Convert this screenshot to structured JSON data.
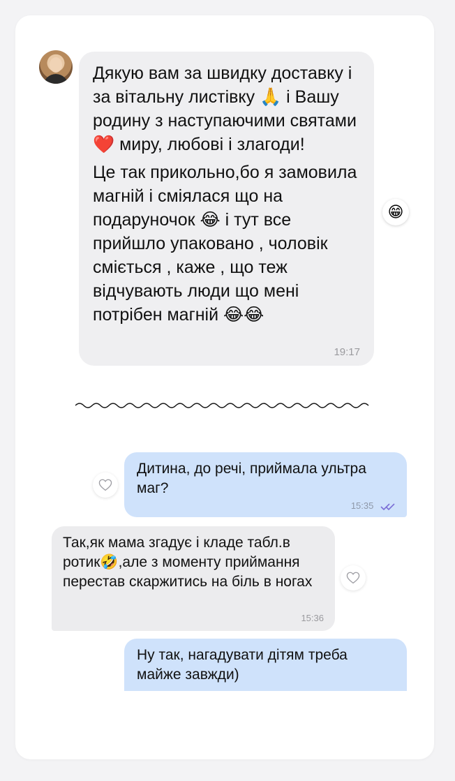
{
  "review": {
    "message_paragraphs": [
      "Дякую вам за швидку доставку і за вітальну листівку 🙏 і Вашу родину з наступаючими святами ❤️ миру, любові і злагоди!",
      "Це так прикольно,бо я замовила магній і сміялася що на подаруночок 😂 і тут все прийшло упаковано , чоловік сміється , каже , що теж відчувають люди що мені потрібен магній 😂😂"
    ],
    "message_time": "19:17",
    "reaction_emoji": "😁"
  },
  "chat": {
    "messages": [
      {
        "direction": "out",
        "text": "Дитина, до речі, приймала ультра маг?",
        "time": "15:35",
        "read": true
      },
      {
        "direction": "in",
        "text": "Так,як мама згадує і кладе табл.в ротик🤣,але з моменту приймання перестав скаржитись на біль в ногах",
        "time": "15:36"
      },
      {
        "direction": "out",
        "text": "Ну так, нагадувати дітям треба майже завжди)"
      }
    ]
  },
  "colors": {
    "outgoing_bubble": "#cfe2fb",
    "incoming_bubble": "#ececee",
    "read_checks": "#7b6fd6"
  }
}
